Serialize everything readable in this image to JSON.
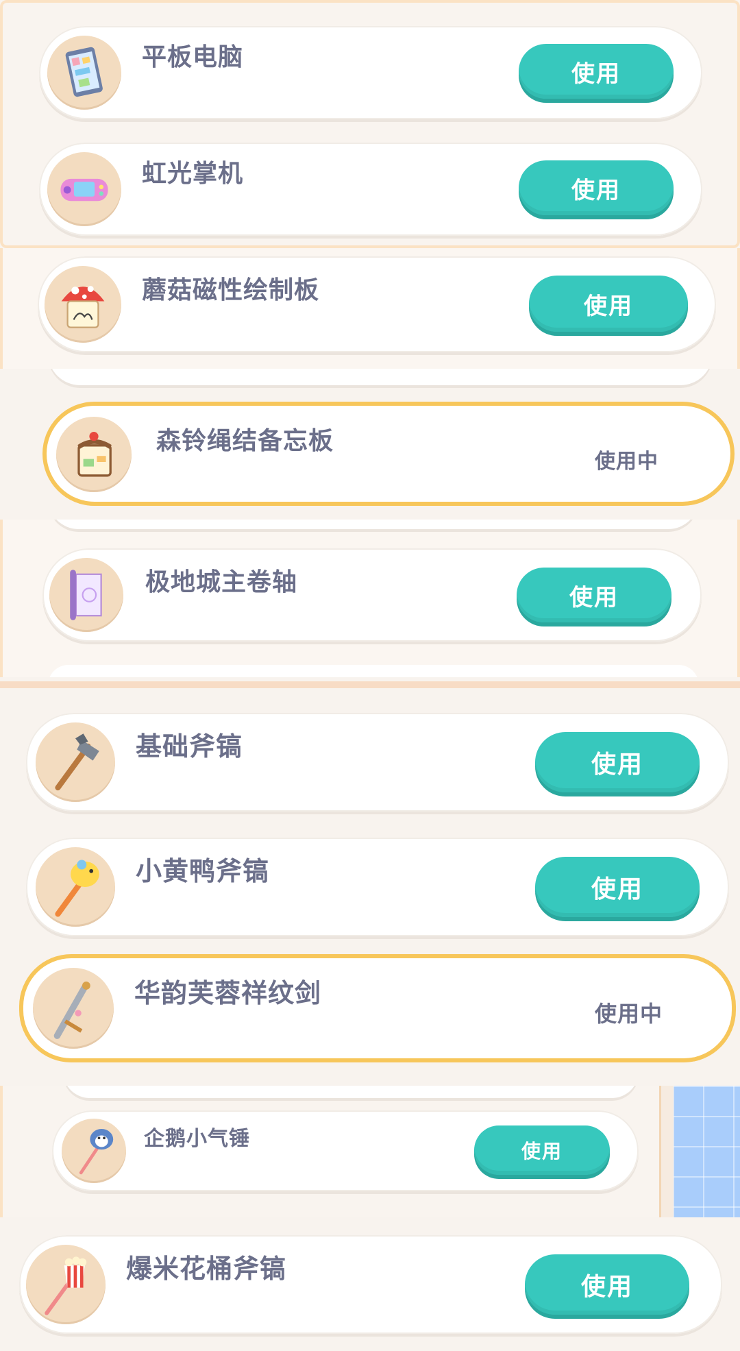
{
  "colors": {
    "button_bg": "#37c8bd",
    "active_border": "#f7c65a",
    "text": "#6b6f8a",
    "page_bg": "#f8f3ee"
  },
  "items": [
    {
      "name": "平板电脑",
      "action": "使用",
      "icon": "tablet-icon"
    },
    {
      "name": "虹光掌机",
      "action": "使用",
      "icon": "handheld-console-icon"
    },
    {
      "name": "蘑菇磁性绘制板",
      "action": "使用",
      "icon": "mushroom-drawing-board-icon"
    },
    {
      "name": "森铃绳结备忘板",
      "action": "使用中",
      "icon": "memo-board-icon"
    },
    {
      "name": "极地城主卷轴",
      "action": "使用",
      "icon": "scroll-icon"
    },
    {
      "name": "基础斧镐",
      "action": "使用",
      "icon": "axe-icon"
    },
    {
      "name": "小黄鸭斧镐",
      "action": "使用",
      "icon": "duck-hammer-icon"
    },
    {
      "name": "华韵芙蓉祥纹剑",
      "action": "使用中",
      "icon": "sword-icon"
    },
    {
      "name": "企鹅小气锤",
      "action": "使用",
      "icon": "penguin-hammer-icon"
    },
    {
      "name": "爆米花桶斧镐",
      "action": "使用",
      "icon": "popcorn-axe-icon"
    }
  ]
}
